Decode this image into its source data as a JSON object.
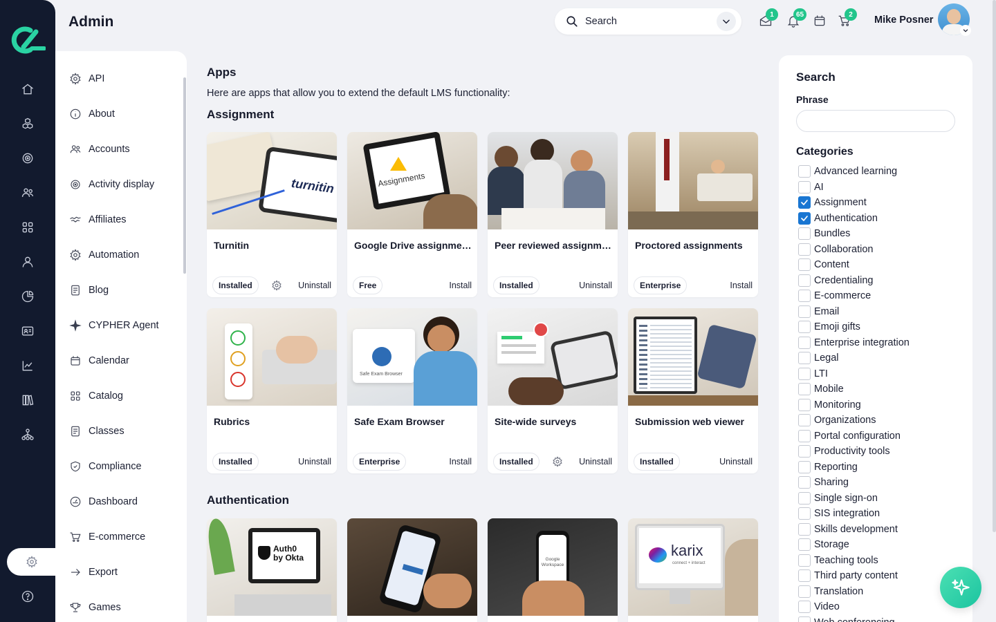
{
  "header": {
    "title": "Admin",
    "search_label": "Search",
    "badges": {
      "messages": "1",
      "notifications": "65",
      "cart": "2"
    },
    "user_name": "Mike Posner"
  },
  "colors": {
    "rail": "#121a2e",
    "accent": "#22c58b",
    "checkbox": "#1976d2",
    "logo": "#2ad3a3"
  },
  "rail_icons": [
    "home-icon",
    "cubes-icon",
    "target-icon",
    "users-icon",
    "grid-icon",
    "user-icon",
    "pie-chart-icon",
    "id-card-icon",
    "line-chart-icon",
    "library-icon",
    "hierarchy-icon",
    "gear-icon",
    "help-icon"
  ],
  "settings_menu": [
    {
      "label": "API",
      "icon": "gear-icon"
    },
    {
      "label": "About",
      "icon": "info-icon"
    },
    {
      "label": "Accounts",
      "icon": "accounts-icon"
    },
    {
      "label": "Activity display",
      "icon": "target-icon"
    },
    {
      "label": "Affiliates",
      "icon": "handshake-icon"
    },
    {
      "label": "Automation",
      "icon": "gear-icon"
    },
    {
      "label": "Blog",
      "icon": "document-icon"
    },
    {
      "label": "CYPHER Agent",
      "icon": "sparkle-icon"
    },
    {
      "label": "Calendar",
      "icon": "calendar-icon"
    },
    {
      "label": "Catalog",
      "icon": "grid-icon"
    },
    {
      "label": "Classes",
      "icon": "document-icon"
    },
    {
      "label": "Compliance",
      "icon": "shield-icon"
    },
    {
      "label": "Dashboard",
      "icon": "dashboard-icon"
    },
    {
      "label": "E-commerce",
      "icon": "cart-icon"
    },
    {
      "label": "Export",
      "icon": "arrow-right-icon"
    },
    {
      "label": "Games",
      "icon": "trophy-icon"
    }
  ],
  "main": {
    "title": "Apps",
    "description": "Here are apps that allow you to extend the default LMS functionality:",
    "sections": [
      {
        "title": "Assignment",
        "apps": [
          {
            "name": "Turnitin",
            "tag": "Installed",
            "action": "Uninstall",
            "has_settings": true,
            "image": "turnitin"
          },
          {
            "name": "Google Drive assignments",
            "tag": "Free",
            "action": "Install",
            "has_settings": false,
            "image": "gdrive"
          },
          {
            "name": "Peer reviewed assignments",
            "tag": "Installed",
            "action": "Uninstall",
            "has_settings": false,
            "image": "peer"
          },
          {
            "name": "Proctored assignments",
            "tag": "Enterprise",
            "action": "Install",
            "has_settings": false,
            "image": "proctored"
          },
          {
            "name": "Rubrics",
            "tag": "Installed",
            "action": "Uninstall",
            "has_settings": false,
            "image": "rubrics"
          },
          {
            "name": "Safe Exam Browser",
            "tag": "Enterprise",
            "action": "Install",
            "has_settings": false,
            "image": "seb"
          },
          {
            "name": "Site-wide surveys",
            "tag": "Installed",
            "action": "Uninstall",
            "has_settings": true,
            "image": "surveys"
          },
          {
            "name": "Submission web viewer",
            "tag": "Installed",
            "action": "Uninstall",
            "has_settings": false,
            "image": "viewer"
          }
        ]
      },
      {
        "title": "Authentication",
        "apps": [
          {
            "image": "auth0",
            "img_text": "Auth0 by Okta"
          },
          {
            "image": "phone"
          },
          {
            "image": "gworkspace",
            "img_text": "Google Workspace"
          },
          {
            "image": "karix",
            "img_text": "karix",
            "img_subtext": "connect + interact"
          }
        ]
      }
    ],
    "image_texts": {
      "turnitin": "turnitin",
      "gdrive": "Assignments",
      "seb": "Safe Exam Browser"
    }
  },
  "filters": {
    "title": "Search",
    "phrase_label": "Phrase",
    "phrase_value": "",
    "categories_title": "Categories",
    "categories": [
      {
        "label": "Advanced learning",
        "checked": false
      },
      {
        "label": "AI",
        "checked": false
      },
      {
        "label": "Assignment",
        "checked": true
      },
      {
        "label": "Authentication",
        "checked": true
      },
      {
        "label": "Bundles",
        "checked": false
      },
      {
        "label": "Collaboration",
        "checked": false
      },
      {
        "label": "Content",
        "checked": false
      },
      {
        "label": "Credentialing",
        "checked": false
      },
      {
        "label": "E-commerce",
        "checked": false
      },
      {
        "label": "Email",
        "checked": false
      },
      {
        "label": "Emoji gifts",
        "checked": false
      },
      {
        "label": "Enterprise integration",
        "checked": false
      },
      {
        "label": "Legal",
        "checked": false
      },
      {
        "label": "LTI",
        "checked": false
      },
      {
        "label": "Mobile",
        "checked": false
      },
      {
        "label": "Monitoring",
        "checked": false
      },
      {
        "label": "Organizations",
        "checked": false
      },
      {
        "label": "Portal configuration",
        "checked": false
      },
      {
        "label": "Productivity tools",
        "checked": false
      },
      {
        "label": "Reporting",
        "checked": false
      },
      {
        "label": "Sharing",
        "checked": false
      },
      {
        "label": "Single sign-on",
        "checked": false
      },
      {
        "label": "SIS integration",
        "checked": false
      },
      {
        "label": "Skills development",
        "checked": false
      },
      {
        "label": "Storage",
        "checked": false
      },
      {
        "label": "Teaching tools",
        "checked": false
      },
      {
        "label": "Third party content",
        "checked": false
      },
      {
        "label": "Translation",
        "checked": false
      },
      {
        "label": "Video",
        "checked": false
      },
      {
        "label": "Web conferencing",
        "checked": false
      }
    ]
  }
}
